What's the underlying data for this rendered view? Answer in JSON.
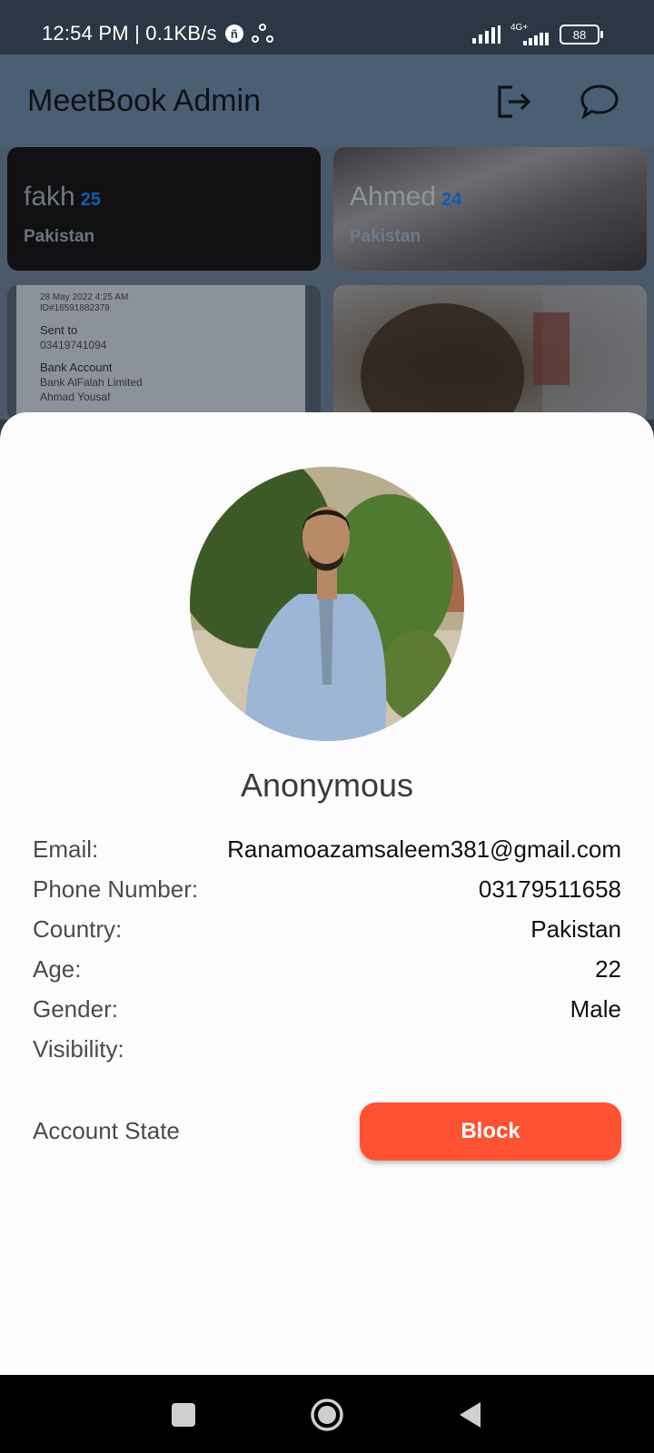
{
  "status_bar": {
    "time_net": "12:54 PM | 0.1KB/s",
    "network": "4G+",
    "battery": "88"
  },
  "app_bar": {
    "title": "MeetBook Admin"
  },
  "cards": [
    {
      "name": "fakh",
      "age": "25",
      "country": "Pakistan"
    },
    {
      "name": "Ahmed",
      "age": "24",
      "country": "Pakistan"
    }
  ],
  "receipt": {
    "datetime": "28 May 2022   4:25 AM",
    "id": "ID#16591882379",
    "sent_to_label": "Sent to",
    "sent_to_value": "03419741094",
    "bank_label": "Bank Account",
    "bank_name": "Bank AlFalah Limited",
    "account_holder": "Ahmad Yousaf"
  },
  "profile": {
    "display_name": "Anonymous",
    "email_label": "Email:",
    "email": "Ranamoazamsaleem381@gmail.com",
    "phone_label": "Phone Number:",
    "phone": "03179511658",
    "country_label": "Country:",
    "country": "Pakistan",
    "age_label": "Age:",
    "age": "22",
    "gender_label": "Gender:",
    "gender": "Male",
    "visibility_label": "Visibility:",
    "visibility": "",
    "account_state_label": "Account State",
    "block_label": "Block"
  },
  "colors": {
    "accent_block": "#ff5233",
    "app_bar": "#4a5f74",
    "age_badge": "#0d5fb0"
  }
}
